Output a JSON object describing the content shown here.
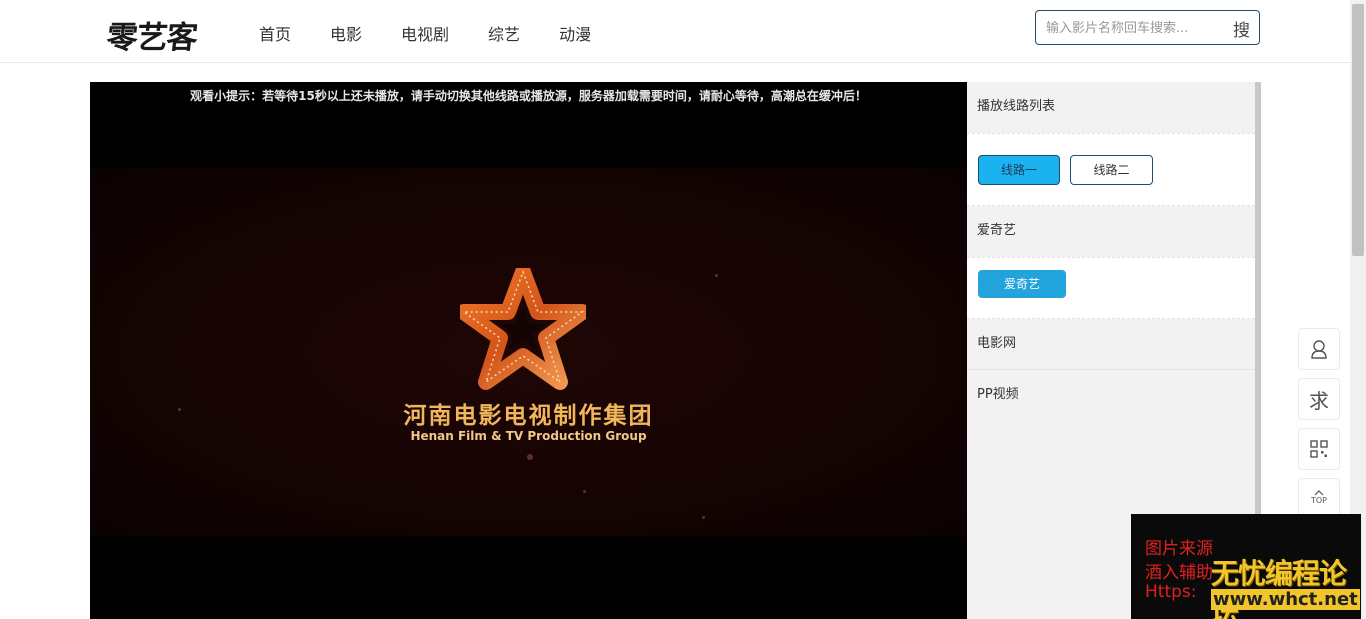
{
  "site": {
    "logo": "零艺客"
  },
  "nav": [
    "首页",
    "电影",
    "电视剧",
    "综艺",
    "动漫"
  ],
  "search": {
    "placeholder": "输入影片名称回车搜索...",
    "button": "搜"
  },
  "player": {
    "tip": "观看小提示：若等待15秒以上还未播放，请手动切换其他线路或播放源，服务器加载需要时间，请耐心等待，高潮总在缓冲后！",
    "studio_cn": "河南电影电视制作集团",
    "studio_en": "Henan Film & TV Production Group"
  },
  "sidebar": {
    "section1_title": "播放线路列表",
    "lines": [
      "线路一",
      "线路二"
    ],
    "section2_title": "爱奇艺",
    "source_button": "爱奇艺",
    "section3_title": "电影网",
    "section4_title": "PP视频"
  },
  "float_tools": {
    "request": "求",
    "top": "TOP"
  },
  "watermark": {
    "line1": "图片来源",
    "line2": "酒入辅助",
    "line3": "Https:",
    "brand": "无忧编程论坛",
    "url": "www.whct.net"
  },
  "colors": {
    "active_line": "#1ab3f0",
    "source_button": "#22a3dc",
    "studio_gold": "#f0b65a"
  }
}
